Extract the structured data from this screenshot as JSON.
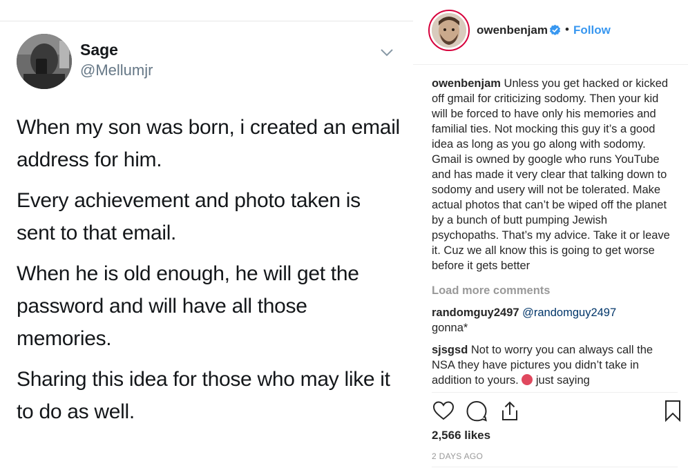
{
  "tweet": {
    "name": "Sage",
    "handle": "@Mellumjr",
    "paragraphs": [
      "When my son was born, i created an email address for him.",
      "Every achievement and photo taken is sent to that email.",
      "When he is old enough, he will get the password and will have all those memories.",
      "Sharing this idea for those who may like it to do as well."
    ]
  },
  "instagram": {
    "username": "owenbenjam",
    "separator": "•",
    "follow_label": "Follow",
    "caption": {
      "username": "owenbenjam",
      "text": "Unless you get hacked or kicked off gmail for criticizing sodomy. Then your kid will be forced to have only his memories and familial ties. Not mocking this guy it’s a good idea as long as you go along with sodomy. Gmail is owned by google who runs YouTube and has made it very clear that talking down to sodomy and usery will not be tolerated. Make actual photos that can’t be wiped off the planet by a bunch of butt pumping Jewish psychopaths. That’s my advice. Take it or leave it. Cuz we all know this is going to get worse before it gets better"
    },
    "load_more": "Load more comments",
    "comments": [
      {
        "username": "randomguy2497",
        "mention": "@randomguy2497",
        "text": "gonna*"
      },
      {
        "username": "sjsgsd",
        "text": "Not to worry you can always call the NSA they have pictures you didn’t take in addition to yours.",
        "text_after_emoji": "just saying"
      }
    ],
    "likes": "2,566 likes",
    "time": "2 DAYS AGO",
    "colors": {
      "accent": "#3897f0",
      "ring": "#d6003b",
      "muted": "#999999",
      "verified": "#3897f0"
    }
  }
}
